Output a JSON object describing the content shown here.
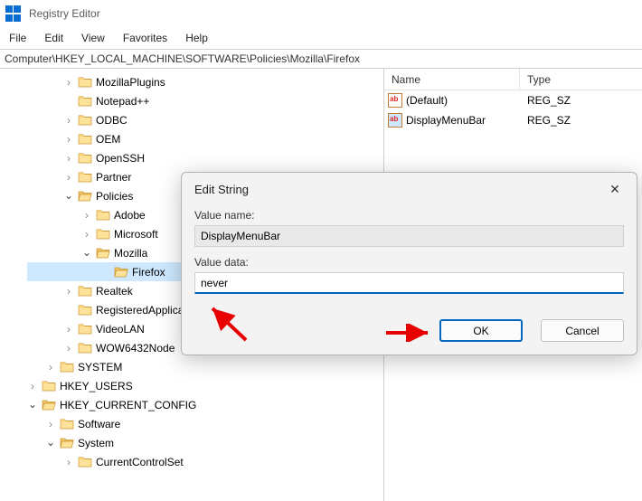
{
  "app": {
    "title": "Registry Editor"
  },
  "menu": [
    "File",
    "Edit",
    "View",
    "Favorites",
    "Help"
  ],
  "address": "Computer\\HKEY_LOCAL_MACHINE\\SOFTWARE\\Policies\\Mozilla\\Firefox",
  "tree": [
    {
      "indent": 2,
      "arrow": "closed",
      "label": "MozillaPlugins",
      "open": false
    },
    {
      "indent": 2,
      "arrow": "none",
      "label": "Notepad++"
    },
    {
      "indent": 2,
      "arrow": "closed",
      "label": "ODBC"
    },
    {
      "indent": 2,
      "arrow": "closed",
      "label": "OEM"
    },
    {
      "indent": 2,
      "arrow": "closed",
      "label": "OpenSSH"
    },
    {
      "indent": 2,
      "arrow": "closed",
      "label": "Partner"
    },
    {
      "indent": 2,
      "arrow": "open",
      "label": "Policies",
      "open": true
    },
    {
      "indent": 3,
      "arrow": "closed",
      "label": "Adobe"
    },
    {
      "indent": 3,
      "arrow": "closed",
      "label": "Microsoft"
    },
    {
      "indent": 3,
      "arrow": "open",
      "label": "Mozilla",
      "open": true
    },
    {
      "indent": 4,
      "arrow": "none",
      "label": "Firefox",
      "open": true,
      "selected": true
    },
    {
      "indent": 2,
      "arrow": "closed",
      "label": "Realtek"
    },
    {
      "indent": 2,
      "arrow": "none",
      "label": "RegisteredApplications"
    },
    {
      "indent": 2,
      "arrow": "closed",
      "label": "VideoLAN"
    },
    {
      "indent": 2,
      "arrow": "closed",
      "label": "WOW6432Node"
    },
    {
      "indent": 1,
      "arrow": "closed",
      "label": "SYSTEM"
    },
    {
      "indent": 0,
      "arrow": "closed",
      "label": "HKEY_USERS"
    },
    {
      "indent": 0,
      "arrow": "open",
      "label": "HKEY_CURRENT_CONFIG",
      "open": true
    },
    {
      "indent": 1,
      "arrow": "closed",
      "label": "Software"
    },
    {
      "indent": 1,
      "arrow": "open",
      "label": "System",
      "open": true
    },
    {
      "indent": 2,
      "arrow": "closed",
      "label": "CurrentControlSet"
    }
  ],
  "list": {
    "columns": {
      "name": "Name",
      "type": "Type"
    },
    "rows": [
      {
        "name": "(Default)",
        "type": "REG_SZ",
        "sel": false
      },
      {
        "name": "DisplayMenuBar",
        "type": "REG_SZ",
        "sel": true
      }
    ]
  },
  "dialog": {
    "title": "Edit String",
    "valueNameLabel": "Value name:",
    "valueName": "DisplayMenuBar",
    "valueDataLabel": "Value data:",
    "valueData": "never",
    "ok": "OK",
    "cancel": "Cancel"
  }
}
